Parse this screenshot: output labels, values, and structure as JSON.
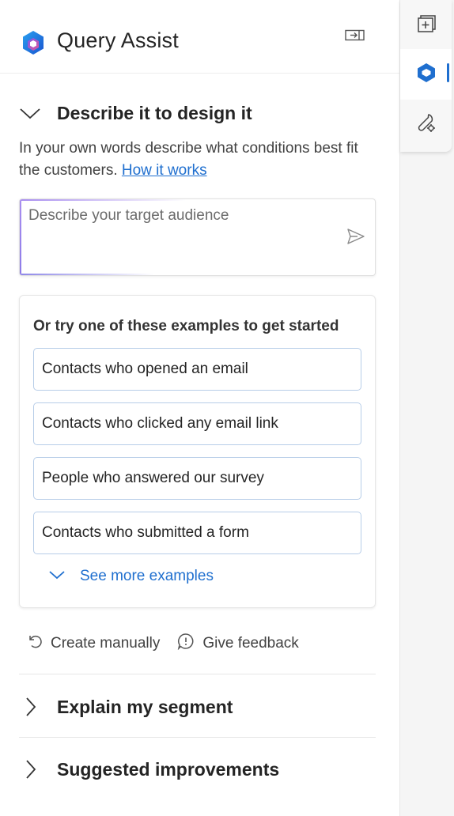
{
  "header": {
    "title": "Query Assist",
    "logo_icon": "copilot-logo-icon",
    "dock_icon": "dock-panel-icon"
  },
  "describe_section": {
    "heading": "Describe it to design it",
    "description": "In your own words describe what conditions best fit the customers.",
    "link_label": "How it works",
    "prompt": {
      "placeholder": "Describe your target audience",
      "value": ""
    },
    "send_icon": "send-icon"
  },
  "examples": {
    "title": "Or try one of these examples to get started",
    "items": [
      "Contacts who opened an email",
      "Contacts who clicked any email link",
      "People who answered our survey",
      "Contacts who submitted a form"
    ],
    "see_more_label": "See more examples"
  },
  "actions": {
    "create_manually": "Create manually",
    "give_feedback": "Give feedback"
  },
  "sections": {
    "explain": "Explain my segment",
    "improvements": "Suggested improvements"
  },
  "rail": {
    "items": [
      "add-panel-icon",
      "copilot-icon",
      "tools-settings-icon"
    ],
    "active": "copilot-icon"
  },
  "colors": {
    "accent": "#1f6fcf",
    "chip_border": "#b7cde8",
    "prompt_glow": "#a98ef0"
  }
}
